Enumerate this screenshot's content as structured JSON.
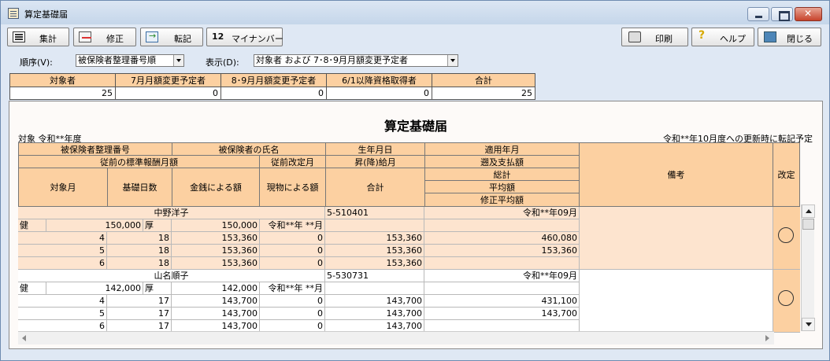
{
  "window": {
    "title": "算定基礎届"
  },
  "toolbar": {
    "sum": "集計",
    "edit": "修正",
    "post": "転記",
    "mynumber_icon": "12",
    "mynumber": "マイナンバー",
    "print": "印刷",
    "help": "ヘルプ",
    "close": "閉じる"
  },
  "controls": {
    "order_label": "順序(V):",
    "order_value": "被保険者整理番号順",
    "display_label": "表示(D):",
    "display_value": "対象者 および 7･8･9月月額変更予定者"
  },
  "summary": {
    "headers": [
      "対象者",
      "7月月額変更予定者",
      "8･9月月額変更予定者",
      "6/1以降資格取得者",
      "合計"
    ],
    "values": [
      "25",
      "0",
      "0",
      "0",
      "25"
    ]
  },
  "report": {
    "title": "算定基礎届",
    "target": "対象  令和**年度",
    "note": "令和**年10月度への更新時に転記予定",
    "headers": {
      "insured_no": "被保険者整理番号",
      "insured_name": "被保険者の氏名",
      "birth": "生年月日",
      "apply_month": "適用年月",
      "prev_standard": "従前の標準報酬月額",
      "prev_revision": "従前改定月",
      "promo": "昇(降)給月",
      "retro": "遡及支払額",
      "month": "対象月",
      "base_days": "基礎日数",
      "cash": "金銭による額",
      "inkind": "現物による額",
      "total": "合計",
      "grand_total": "総計",
      "average": "平均額",
      "adj_average": "修正平均額",
      "remarks": "備考",
      "revision": "改定"
    },
    "employees": [
      {
        "name": "中野洋子",
        "birth": "5-510401",
        "apply": "令和**年09月",
        "health": "健",
        "prev_amount": "150,000",
        "pension": "厚",
        "pension_amount": "150,000",
        "prev_revision": "令和**年 **月",
        "months": [
          {
            "m": "4",
            "days": "18",
            "cash": "153,360",
            "inkind": "0",
            "total": "153,360",
            "right": "460,080"
          },
          {
            "m": "5",
            "days": "18",
            "cash": "153,360",
            "inkind": "0",
            "total": "153,360",
            "right": "153,360"
          },
          {
            "m": "6",
            "days": "18",
            "cash": "153,360",
            "inkind": "0",
            "total": "153,360",
            "right": ""
          }
        ]
      },
      {
        "name": "山名順子",
        "birth": "5-530731",
        "apply": "令和**年09月",
        "health": "健",
        "prev_amount": "142,000",
        "pension": "厚",
        "pension_amount": "142,000",
        "prev_revision": "令和**年 **月",
        "months": [
          {
            "m": "4",
            "days": "17",
            "cash": "143,700",
            "inkind": "0",
            "total": "143,700",
            "right": "431,100"
          },
          {
            "m": "5",
            "days": "17",
            "cash": "143,700",
            "inkind": "0",
            "total": "143,700",
            "right": "143,700"
          },
          {
            "m": "6",
            "days": "17",
            "cash": "143,700",
            "inkind": "0",
            "total": "143,700",
            "right": ""
          }
        ]
      }
    ]
  },
  "icons": [
    "calculator-icon",
    "edit-icon",
    "post-icon",
    "mynumber-icon",
    "printer-icon",
    "help-icon",
    "close-door-icon"
  ],
  "colors": {
    "header": "#fcd0a1",
    "row_highlight": "#fde4cf",
    "title_bar": "#c5d6ea"
  }
}
